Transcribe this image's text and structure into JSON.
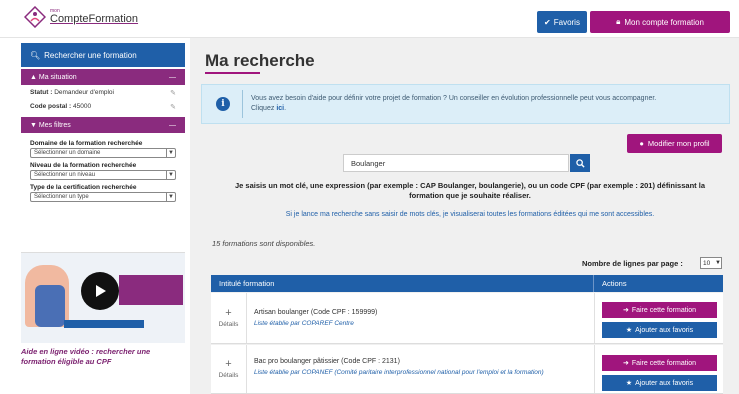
{
  "header": {
    "logo_small": "mon",
    "logo_main": "CompteFormation",
    "favoris_label": "Favoris",
    "account_label": "Mon compte formation"
  },
  "sidebar": {
    "search_label": "Rechercher une formation",
    "situation_label": "Ma situation",
    "statut_label": "Statut :",
    "statut_value": "Demandeur d'emploi",
    "cp_label": "Code postal :",
    "cp_value": "45000",
    "filters_label": "Mes filtres",
    "filters": [
      {
        "label": "Domaine de la formation recherchée",
        "value": "Sélectionner un domaine"
      },
      {
        "label": "Niveau de la formation recherchée",
        "value": "Sélectionner un niveau"
      },
      {
        "label": "Type de la certification recherchée",
        "value": "Sélectionner un type"
      }
    ],
    "video_caption": "Aide en ligne vidéo : rechercher une formation éligible au CPF"
  },
  "main": {
    "title": "Ma recherche",
    "alert_text": "Vous avez besoin d'aide pour définir votre projet de formation ? Un conseiller en évolution professionnelle peut vous accompagner.",
    "alert_cta_prefix": "Cliquez",
    "alert_cta_link": "ici",
    "modify_profile": "Modifier mon profil",
    "search_value": "Boulanger",
    "hint": "Je saisis un mot clé, une expression (par exemple : CAP Boulanger, boulangerie), ou un code CPF (par exemple : 201) définissant la formation que je souhaite réaliser.",
    "no_keyword_link": "Si je lance ma recherche sans saisir de mots clés, je visualiserai toutes les formations éditées qui me sont accessibles.",
    "count": "15 formations sont disponibles.",
    "rows_label": "Nombre de lignes par page :",
    "rows_value": "10",
    "col_formation": "Intitulé formation",
    "col_actions": "Actions",
    "details_label": "Détails",
    "do_label": "Faire cette formation",
    "fav_label": "Ajouter aux favoris",
    "rows": [
      {
        "title": "Artisan boulanger (Code CPF : 159999)",
        "list": "Liste établie par COPAREF Centre"
      },
      {
        "title": "Bac pro boulanger pâtissier (Code CPF : 2131)",
        "list": "Liste établie par COPANEF (Comité paritaire interprofessionnel national pour l'emploi et la formation)"
      }
    ]
  },
  "colors": {
    "primary": "#1f5fa8",
    "accent": "#a0157d",
    "section": "#8a2b7e"
  }
}
